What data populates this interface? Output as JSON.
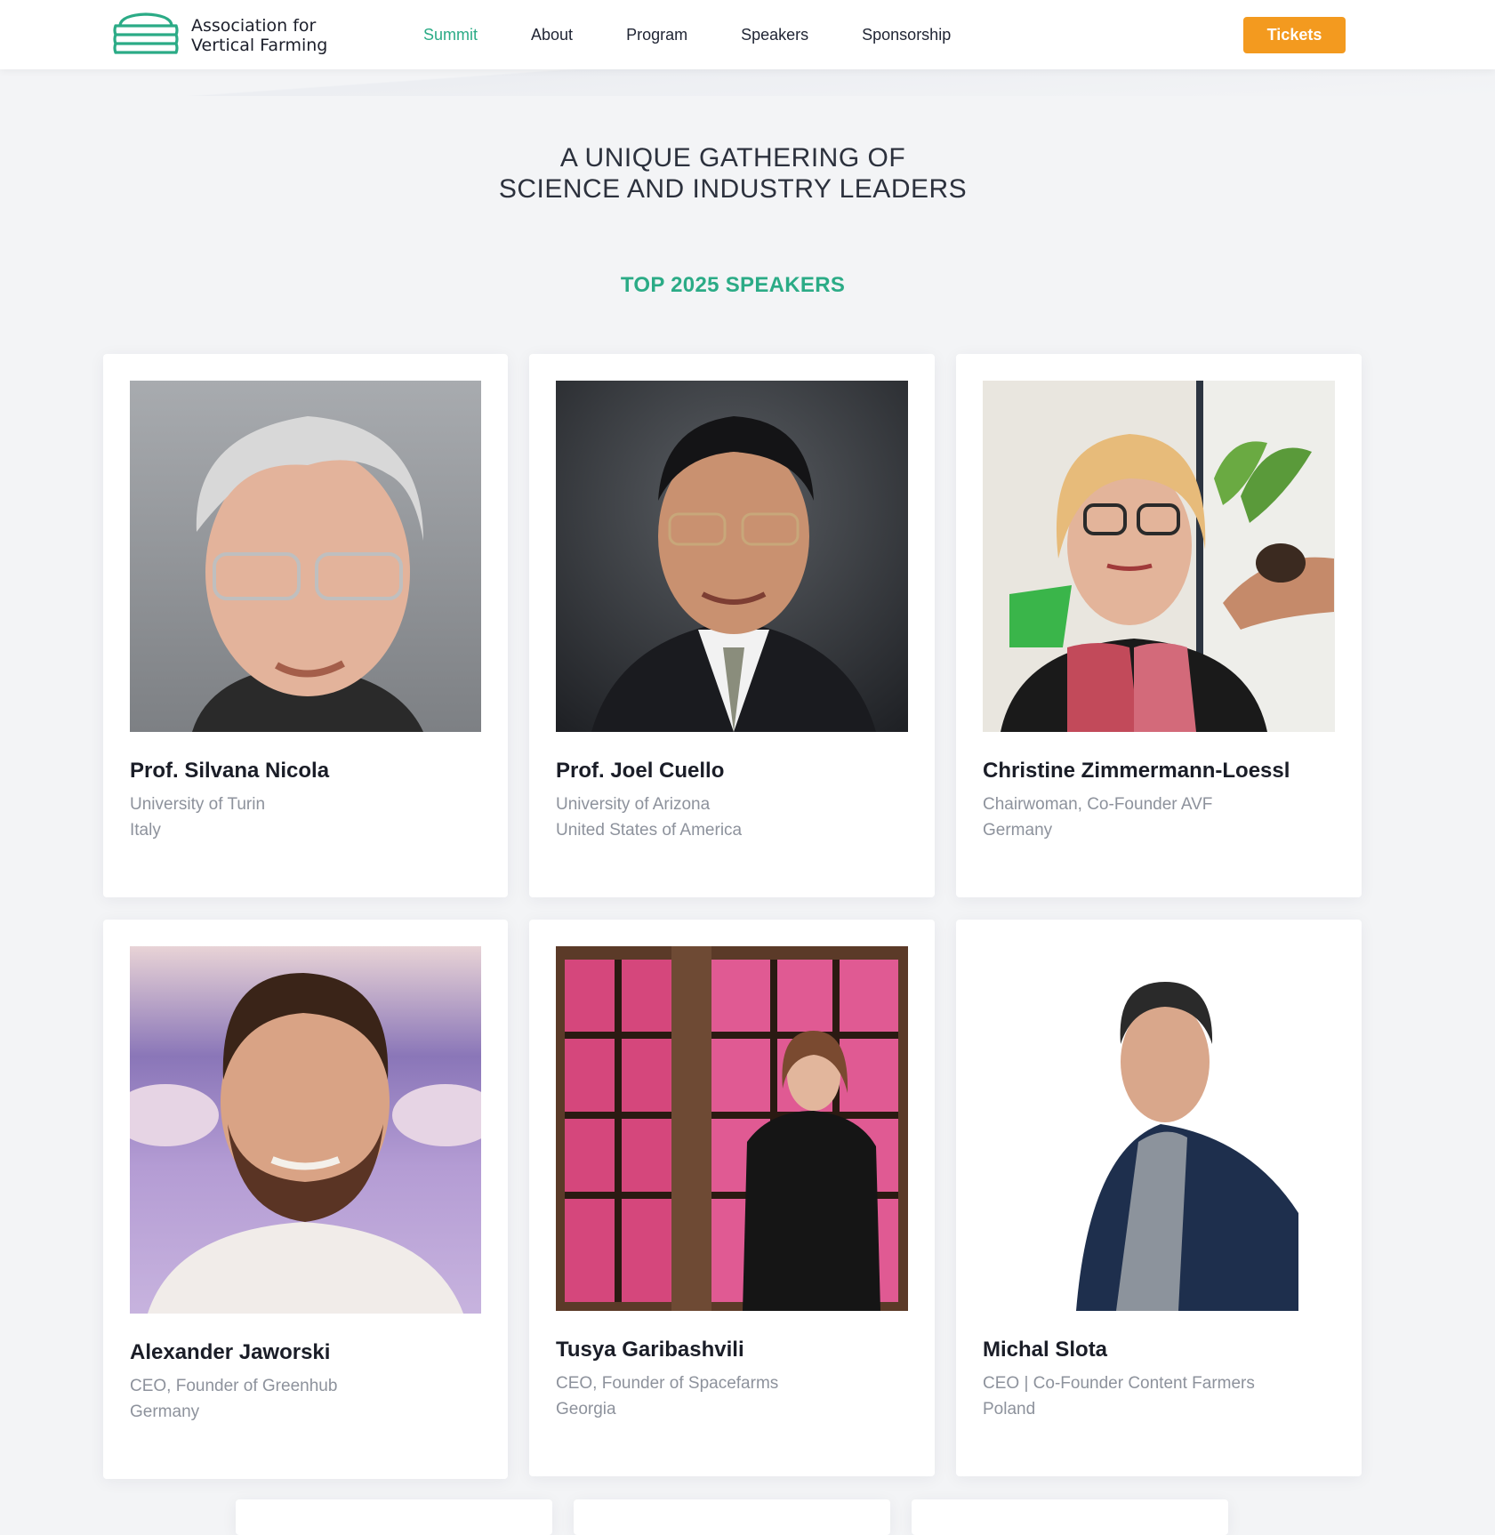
{
  "brand": {
    "line1": "Association for",
    "line2": "Vertical Farming",
    "accent_color": "#2bab86"
  },
  "nav": {
    "items": [
      {
        "label": "Summit",
        "active": true
      },
      {
        "label": "About",
        "active": false
      },
      {
        "label": "Program",
        "active": false
      },
      {
        "label": "Speakers",
        "active": false
      },
      {
        "label": "Sponsorship",
        "active": false
      }
    ],
    "tickets_label": "Tickets",
    "tickets_color": "#f39a1f"
  },
  "hero": {
    "line1": "A UNIQUE GATHERING OF",
    "line2": "SCIENCE AND INDUSTRY LEADERS"
  },
  "speakers_section": {
    "title": "TOP 2025 SPEAKERS",
    "speakers": [
      {
        "name": "Prof. Silvana Nicola",
        "org": "University of Turin",
        "country": "Italy",
        "photo": "portrait-photo"
      },
      {
        "name": "Prof. Joel Cuello",
        "org": "University of Arizona",
        "country": "United States of America",
        "photo": "portrait-photo"
      },
      {
        "name": "Christine Zimmermann-Loessl",
        "org": "Chairwoman, Co-Founder AVF",
        "country": "Germany",
        "photo": "portrait-photo"
      },
      {
        "name": "Alexander Jaworski",
        "org": "CEO, Founder of Greenhub",
        "country": "Germany",
        "photo": "portrait-photo"
      },
      {
        "name": "Tusya Garibashvili",
        "org": "CEO, Founder of Spacefarms",
        "country": "Georgia",
        "photo": "portrait-photo"
      },
      {
        "name": "Michal Slota",
        "org": "CEO | Co-Founder Content Farmers",
        "country": "Poland",
        "photo": "portrait-photo"
      }
    ]
  }
}
